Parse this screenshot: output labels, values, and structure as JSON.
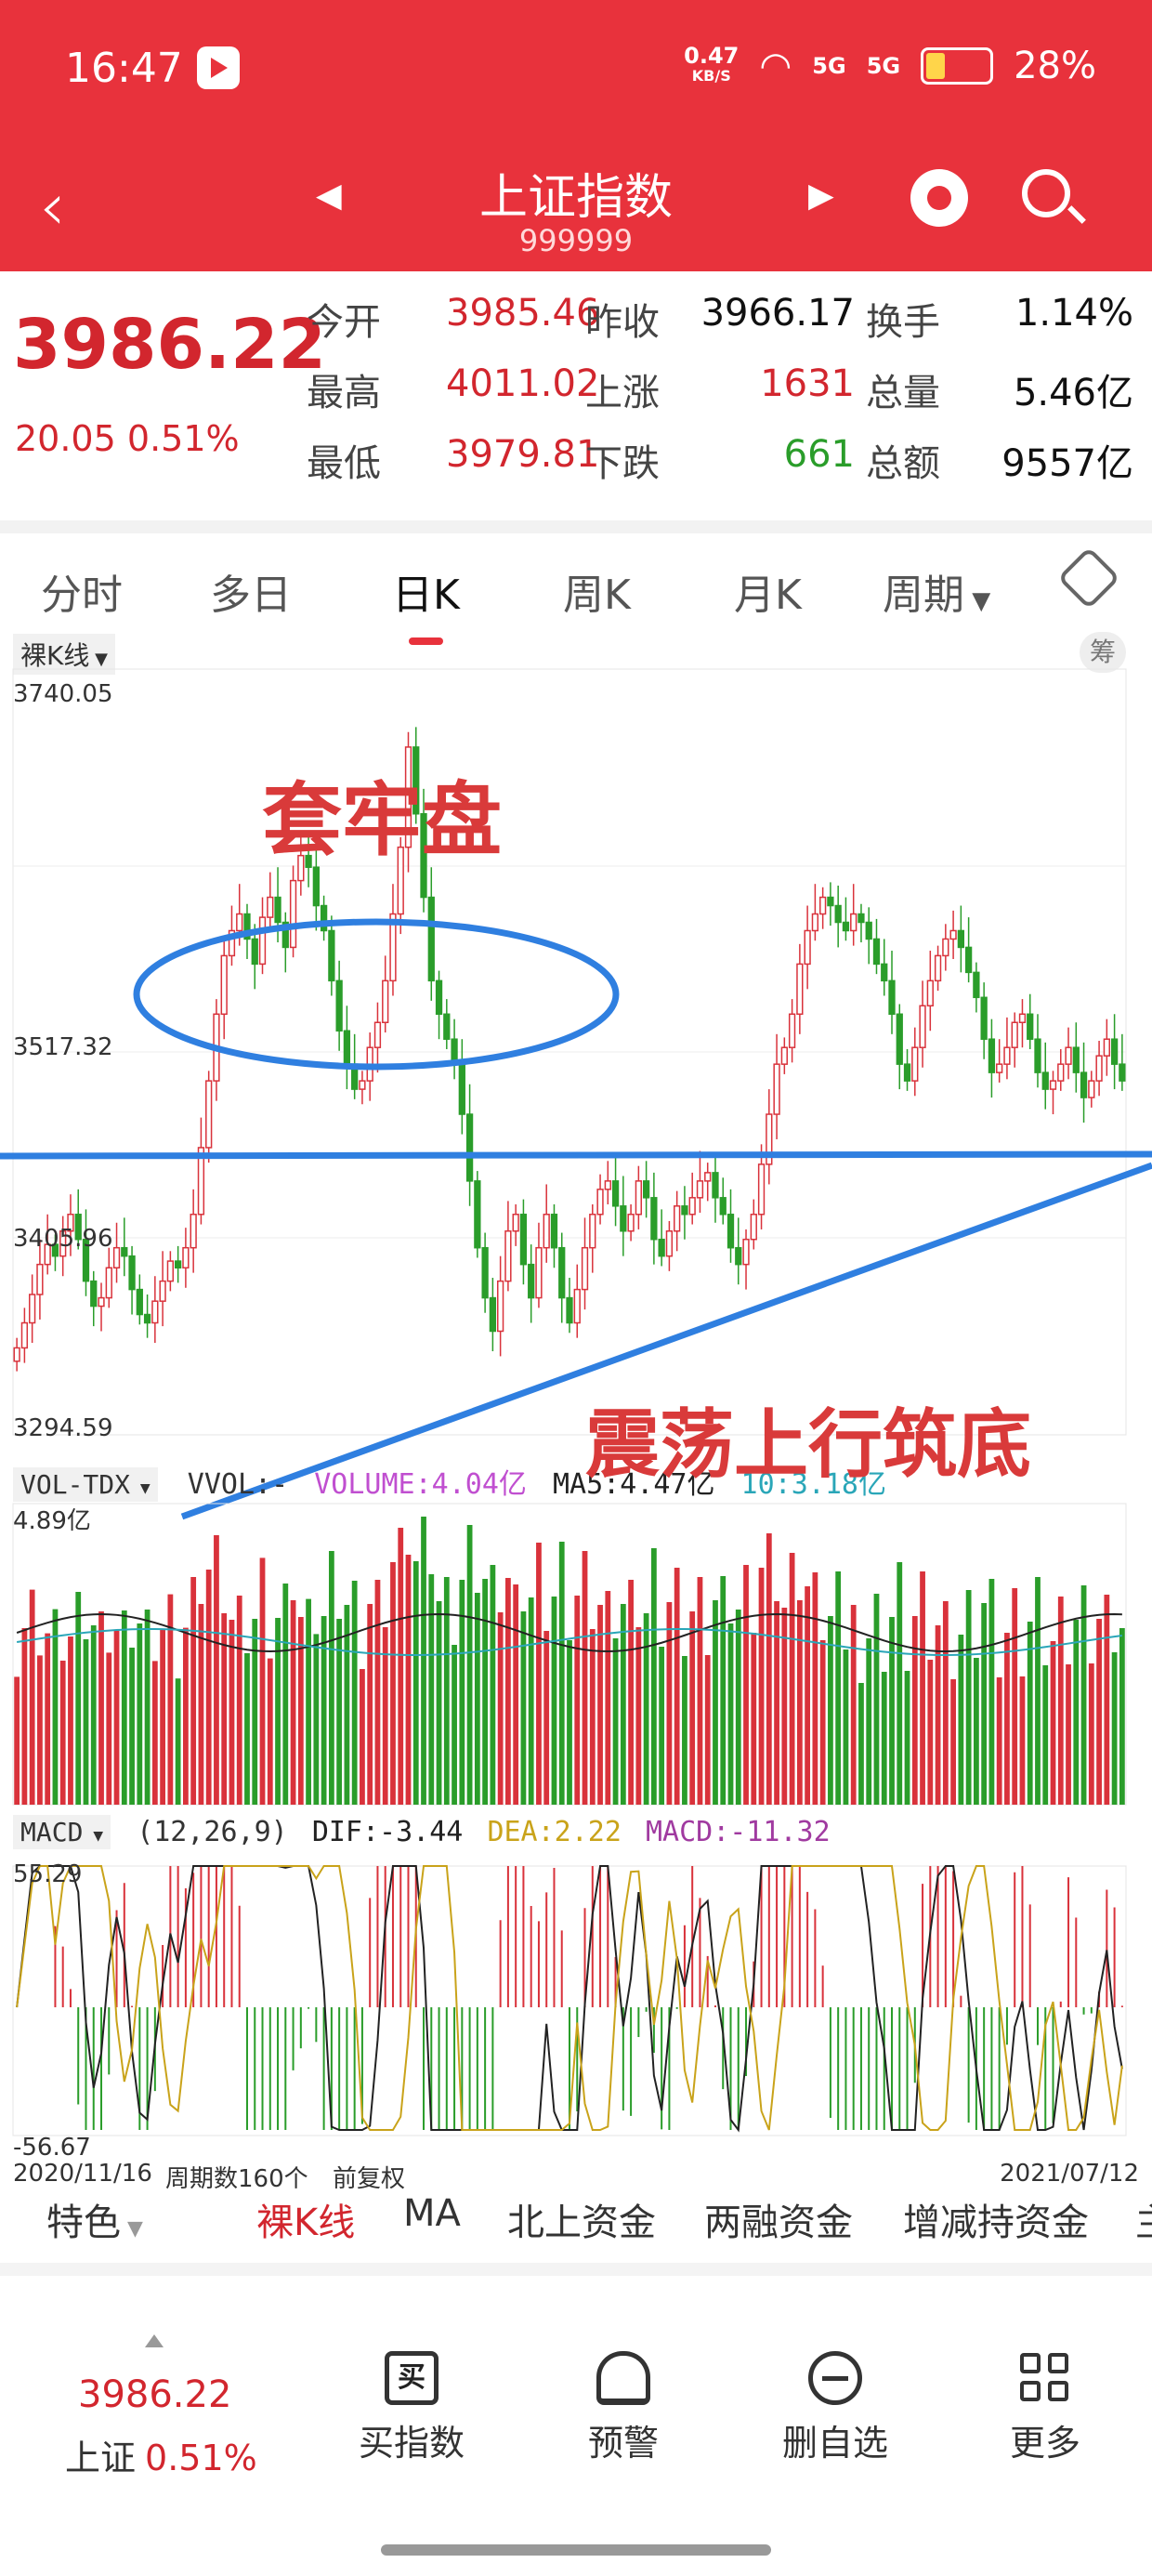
{
  "status_bar": {
    "time": "16:47",
    "net_speed": "0.47",
    "net_unit": "KB/S",
    "signal1": "5G",
    "signal2": "5G",
    "battery": "28%"
  },
  "header": {
    "title": "上证指数",
    "code": "999999"
  },
  "quote": {
    "price": "3986.22",
    "change": "20.05",
    "change_pct": "0.51%",
    "rows": [
      {
        "l1": "今开",
        "v1": "3985.46",
        "l2": "昨收",
        "v2": "3966.17",
        "l3": "换手",
        "v3": "1.14%"
      },
      {
        "l1": "最高",
        "v1": "4011.02",
        "l2": "上涨",
        "v2": "1631",
        "l3": "总量",
        "v3": "5.46亿"
      },
      {
        "l1": "最低",
        "v1": "3979.81",
        "l2": "下跌",
        "v2": "661",
        "l3": "总额",
        "v3": "9557亿"
      }
    ]
  },
  "period_tabs": [
    "分时",
    "多日",
    "日K",
    "周K",
    "月K",
    "周期"
  ],
  "active_period_tab": "日K",
  "chart": {
    "kline_mode": "裸K线",
    "chip_label": "筹",
    "price_ticks": [
      "3740.05",
      "3517.32",
      "3405.96",
      "3294.59"
    ],
    "vol_indicator": "VOL-TDX",
    "vol_legend": {
      "vvol": "VVOL:-",
      "volume": "VOLUME:4.04亿",
      "ma5": "MA5:4.47亿",
      "ma10": "10:3.18亿"
    },
    "vol_max": "4.89亿",
    "macd_indicator": "MACD",
    "macd_legend": {
      "params": "(12,26,9)",
      "dif": "DIF:-3.44",
      "dea": "DEA:2.22",
      "macd": "MACD:-11.32"
    },
    "macd_max": "55.29",
    "macd_min": "-56.67",
    "date_start": "2020/11/16",
    "period_count": "周期数160个",
    "adjust": "前复权",
    "date_end": "2021/07/12",
    "annotation_top": "套牢盘",
    "annotation_bottom": "震荡上行筑底",
    "colors": {
      "up": "#d9323b",
      "down": "#2a9d2a",
      "annot_line": "#2f7fe0",
      "ma5": "#222222",
      "ma10": "#2aa6b8",
      "dea": "#c9a31a",
      "macd_text": "#a03aa0"
    }
  },
  "chart_data": {
    "type": "candlestick",
    "ylim": [
      3294.59,
      3740.05
    ],
    "x_start": "2020/11/16",
    "x_end": "2021/07/12",
    "count": 160,
    "close": [
      3340,
      3355,
      3372,
      3390,
      3402,
      3395,
      3410,
      3420,
      3405,
      3380,
      3365,
      3370,
      3388,
      3400,
      3395,
      3375,
      3360,
      3355,
      3368,
      3380,
      3392,
      3388,
      3400,
      3420,
      3460,
      3500,
      3540,
      3575,
      3590,
      3600,
      3585,
      3570,
      3598,
      3610,
      3595,
      3580,
      3620,
      3635,
      3628,
      3605,
      3590,
      3560,
      3530,
      3510,
      3495,
      3500,
      3520,
      3535,
      3560,
      3600,
      3640,
      3700,
      3660,
      3610,
      3560,
      3540,
      3525,
      3510,
      3480,
      3440,
      3400,
      3370,
      3350,
      3380,
      3410,
      3420,
      3390,
      3370,
      3400,
      3420,
      3400,
      3370,
      3355,
      3375,
      3400,
      3420,
      3435,
      3440,
      3425,
      3410,
      3420,
      3440,
      3430,
      3405,
      3395,
      3410,
      3425,
      3420,
      3430,
      3440,
      3445,
      3430,
      3420,
      3400,
      3390,
      3405,
      3420,
      3450,
      3480,
      3510,
      3520,
      3540,
      3570,
      3590,
      3600,
      3610,
      3605,
      3595,
      3590,
      3600,
      3595,
      3585,
      3570,
      3560,
      3540,
      3510,
      3500,
      3520,
      3545,
      3560,
      3575,
      3585,
      3590,
      3580,
      3565,
      3550,
      3525,
      3505,
      3510,
      3520,
      3535,
      3540,
      3525,
      3505,
      3495,
      3500,
      3510,
      3520,
      3505,
      3490,
      3500,
      3515,
      3525,
      3510,
      3500
    ],
    "volume_max": "4.89亿",
    "macd_range": [
      -56.67,
      55.29
    ]
  },
  "sub_tabs": [
    "特色",
    "裸K线",
    "MA",
    "北上资金",
    "两融资金",
    "增减持资金",
    "主"
  ],
  "active_sub_tab": "裸K线",
  "bottom_bar": {
    "price": "3986.22",
    "name": "上证",
    "pct": "0.51%",
    "buttons": [
      {
        "icon": "买",
        "label": "买指数"
      },
      {
        "icon": "",
        "label": "预警"
      },
      {
        "icon": "",
        "label": "删自选"
      },
      {
        "icon": "",
        "label": "更多"
      }
    ]
  }
}
